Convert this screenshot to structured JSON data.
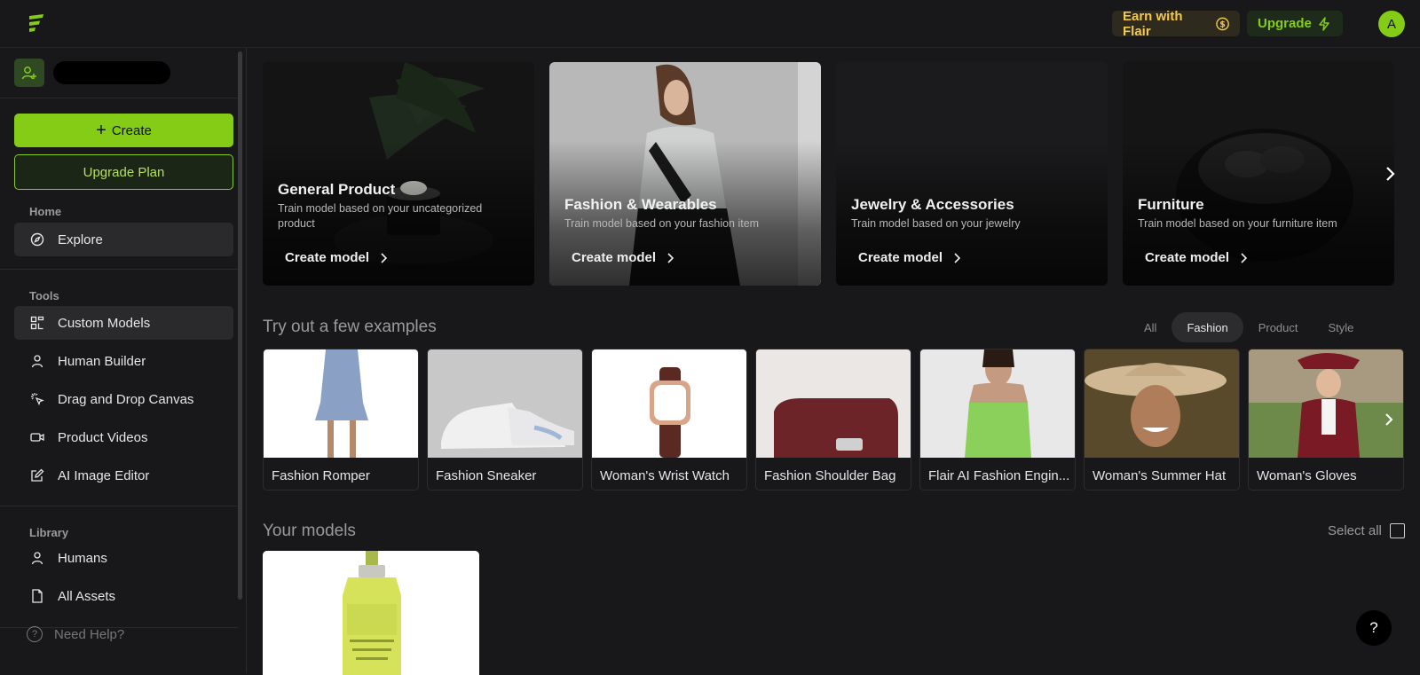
{
  "header": {
    "earn_label": "Earn with Flair",
    "upgrade_label": "Upgrade",
    "avatar_initial": "A"
  },
  "sidebar": {
    "create_label": "Create",
    "upgrade_plan_label": "Upgrade Plan",
    "home_section": "Home",
    "tools_section": "Tools",
    "library_section": "Library",
    "items": {
      "explore": "Explore",
      "custom_models": "Custom Models",
      "human_builder": "Human Builder",
      "drag_drop": "Drag and Drop Canvas",
      "product_videos": "Product Videos",
      "ai_image_editor": "AI Image Editor",
      "humans": "Humans",
      "all_assets": "All Assets"
    },
    "help_label": "Need Help?"
  },
  "categories": [
    {
      "title": "General Product",
      "desc": "Train model based on your uncategorized product",
      "link": "Create model"
    },
    {
      "title": "Fashion & Wearables",
      "desc": "Train model based on your fashion item",
      "link": "Create model"
    },
    {
      "title": "Jewelry & Accessories",
      "desc": "Train model based on your jewelry",
      "link": "Create model"
    },
    {
      "title": "Furniture",
      "desc": "Train model based on your furniture item",
      "link": "Create model"
    }
  ],
  "examples": {
    "title": "Try out a few examples",
    "filters": [
      "All",
      "Fashion",
      "Product",
      "Style"
    ],
    "active_filter": "Fashion",
    "items": [
      "Fashion Romper",
      "Fashion Sneaker",
      "Woman's Wrist Watch",
      "Fashion Shoulder Bag",
      "Flair AI Fashion Engin...",
      "Woman's Summer Hat",
      "Woman's Gloves"
    ]
  },
  "models": {
    "title": "Your models",
    "select_all": "Select all"
  },
  "help_fab": "?",
  "colors": {
    "accent": "#84cc16",
    "earn": "#f2c94c",
    "background": "#18181a"
  }
}
